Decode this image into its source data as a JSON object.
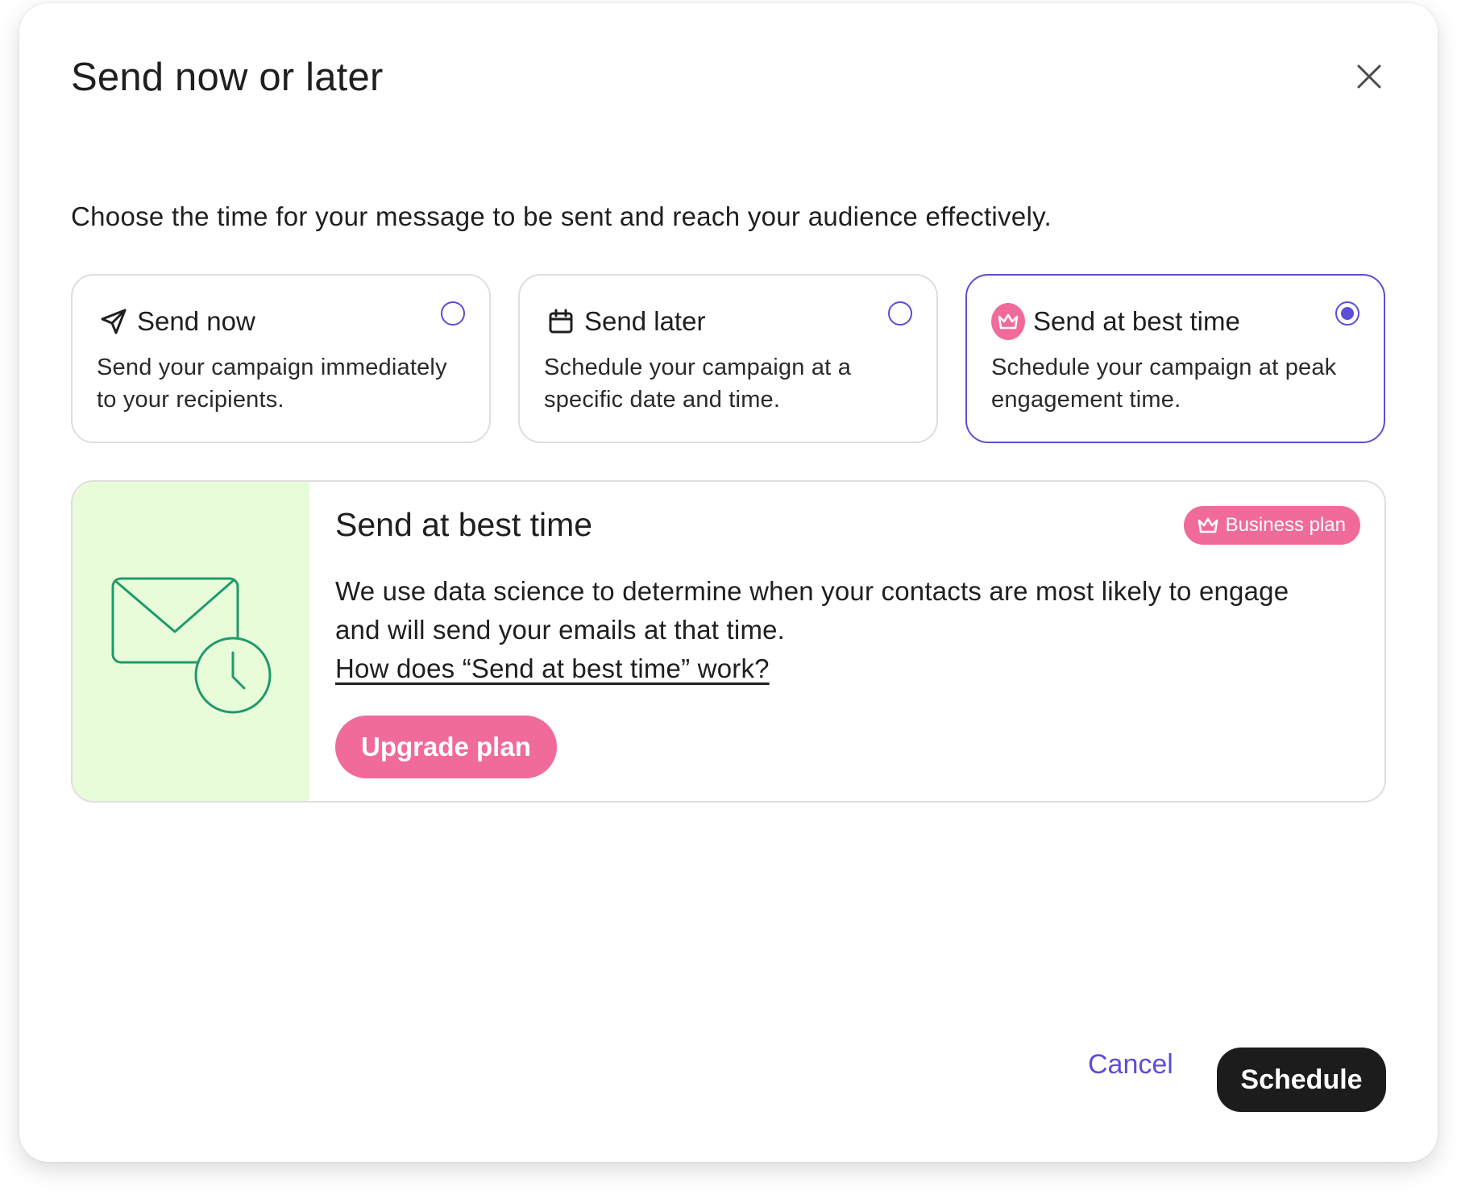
{
  "dialog": {
    "title": "Send now or later",
    "subtitle": "Choose the time for your message to be sent and reach your audience effectively."
  },
  "options": [
    {
      "title": "Send now",
      "description": "Send your campaign immediately to your recipients.",
      "icon": "send-icon",
      "selected": false
    },
    {
      "title": "Send later",
      "description": "Schedule your campaign at a specific date and time.",
      "icon": "calendar-icon",
      "selected": false
    },
    {
      "title": "Send at best time",
      "description": "Schedule your campaign at peak engagement time.",
      "icon": "crown-icon",
      "selected": true
    }
  ],
  "info": {
    "title": "Send at best time",
    "badge": "Business plan",
    "body": "We use data science to determine when your contacts are most likely to engage and will send your emails at that time.",
    "link": "How does “Send at best time” work?",
    "upgrade_label": "Upgrade plan",
    "illustration": "mail-clock-icon"
  },
  "footer": {
    "cancel_label": "Cancel",
    "schedule_label": "Schedule"
  },
  "colors": {
    "accent": "#5b4fd6",
    "pink": "#f06a9b",
    "illustration_bg": "#e8fcd9",
    "illustration_stroke": "#1f9a6e",
    "primary_button": "#1c1c1c"
  }
}
